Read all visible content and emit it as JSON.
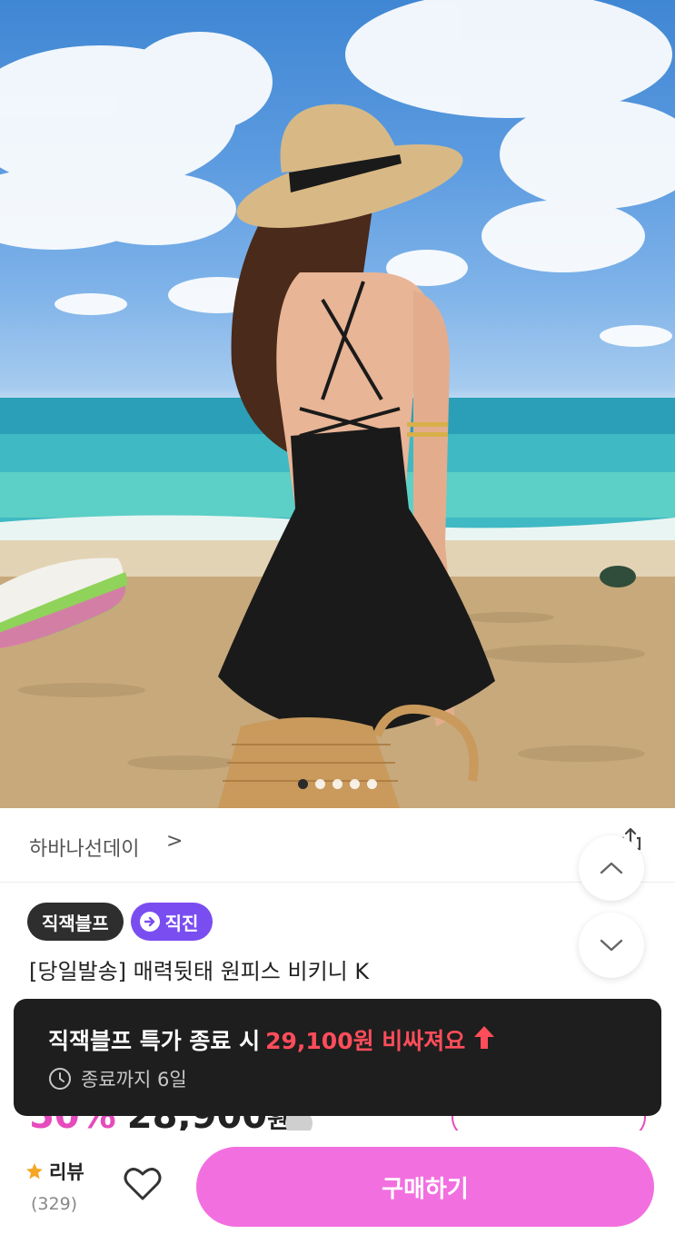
{
  "hero": {
    "image_alt": "beach swimsuit photo",
    "carousel_count": 5,
    "carousel_active_index": 0
  },
  "store": {
    "name": "하바나선데이",
    "chevron": ">"
  },
  "badges": {
    "primary": "직잭블프",
    "secondary": "직진"
  },
  "product": {
    "title": "[당일발송] 매력뒷태 원피스 비키니 K"
  },
  "price_peek": {
    "discount": "50%",
    "amount": "28,900",
    "currency": "원"
  },
  "toast": {
    "prefix": "직잭블프 특가 종료 시",
    "highlight": "29,100원 비싸져요",
    "remaining": "종료까지 6일"
  },
  "bottom_bar": {
    "review_label": "리뷰",
    "review_count": "(329)",
    "buy_label": "구매하기"
  },
  "colors": {
    "accent_pink": "#f26fe0",
    "discount_pink": "#e64bbd",
    "badge_purple": "#7a4df0",
    "toast_bg": "#1e1e1e",
    "toast_highlight": "#ff4d5a",
    "star": "#f5a623"
  },
  "icons": {
    "share": "share-icon",
    "scroll_up": "chevron-up-icon",
    "scroll_down": "chevron-down-icon",
    "clock": "clock-icon",
    "star": "star-icon",
    "heart": "heart-icon",
    "up_arrow": "arrow-up-icon",
    "direct": "arrow-right-circle-icon"
  }
}
